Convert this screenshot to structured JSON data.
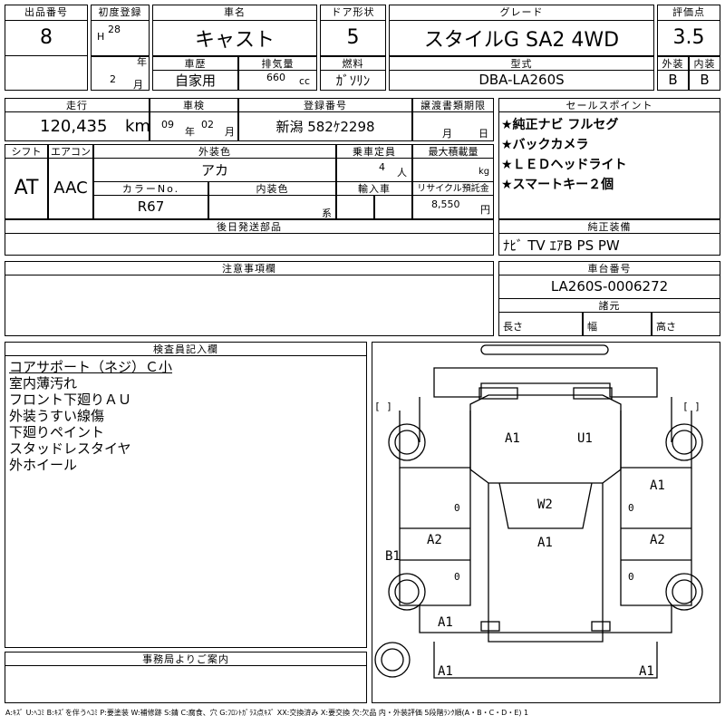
{
  "header": {
    "lot_label": "出品番号",
    "lot_value": "8",
    "first_reg_label": "初度登録",
    "era": "H",
    "year": "28",
    "year_unit": "年",
    "month": "2",
    "month_unit": "月",
    "car_name_label": "車名",
    "car_name": "キャスト",
    "door_label": "ドア形状",
    "door_value": "5",
    "grade_label": "グレード",
    "grade_value": "スタイルG SA2 4WD",
    "score_label": "評価点",
    "score_value": "3.5",
    "history_label": "車歴",
    "history_value": "自家用",
    "displacement_label": "排気量",
    "displacement_value": "660",
    "displacement_unit": "cc",
    "fuel_label": "燃料",
    "fuel_value": "ｶﾞｿﾘﾝ",
    "model_label": "型式",
    "model_value": "DBA-LA260S",
    "exterior_label": "外装",
    "exterior_value": "B",
    "interior_label": "内装",
    "interior_value": "B"
  },
  "row2": {
    "mileage_label": "走行",
    "mileage_value": "120,435",
    "mileage_unit": "km",
    "inspection_label": "車検",
    "inspection_year": "09",
    "inspection_year_unit": "年",
    "inspection_month": "02",
    "inspection_month_unit": "月",
    "reg_no_label": "登録番号",
    "reg_no_value": "新潟 582ｹ2298",
    "transfer_label": "譲渡書類期限",
    "transfer_month_unit": "月",
    "transfer_day_unit": "日"
  },
  "row3": {
    "shift_label": "シフト",
    "shift_value": "AT",
    "ac_label": "エアコン",
    "ac_value": "AAC",
    "color_label": "外装色",
    "color_value": "アカ",
    "capacity_label": "乗車定員",
    "capacity_value": "4",
    "capacity_unit": "人",
    "load_label": "最大積載量",
    "load_unit": "kg",
    "color_no_label": "カラーNo.",
    "color_no_value": "R67",
    "int_color_label": "内装色",
    "int_color_unit": "系",
    "import_label": "輸入車",
    "recycle_label": "リサイクル預託金",
    "recycle_value": "8,550",
    "recycle_unit": "円"
  },
  "sales": {
    "label": "セールスポイント",
    "items": [
      "★純正ナビ フルセグ",
      "★バックカメラ",
      "★ＬＥＤヘッドライト",
      "★スマートキー２個"
    ]
  },
  "later_parts_label": "後日発送部品",
  "equipment": {
    "label": "純正装備",
    "value": "ﾅﾋﾞ TV ｴｱB PS PW"
  },
  "notes_label": "注意事項欄",
  "chassis": {
    "label": "車台番号",
    "value": "LA260S-0006272"
  },
  "dimensions": {
    "label": "諸元",
    "length_label": "長さ",
    "width_label": "幅",
    "height_label": "高さ"
  },
  "inspector": {
    "label": "検査員記入欄",
    "lines": [
      "コアサポート（ネジ）Ｃ小",
      "室内薄汚れ",
      "フロント下廻りＡＵ",
      "外装うすい線傷",
      "下廻りペイント",
      "スタッドレスタイヤ",
      "外ホイール"
    ]
  },
  "office_label": "事務局よりご案内",
  "damage_marks": {
    "front_left": "A1",
    "front_right": "U1",
    "center": "W2",
    "center_lower": "A1",
    "left_mid": "A2",
    "right_mid": "A2",
    "right_upper": "A1",
    "left_b1": "B1",
    "rear_left": "A1",
    "bottom_left": "A1",
    "bottom_right": "A1",
    "zero_left": "0",
    "zero_right": "0",
    "zero_left2": "0",
    "zero_right2": "0",
    "bracket_left": "[   ]",
    "bracket_right": "[   ]"
  },
  "legend": "A:ｷｽﾞ U:ﾍｺﾐ B:ｷｽﾞを伴うﾍｺﾐ P:要塗装 W:補修跡 S:錆 C:腐食、穴 G:ﾌﾛﾝﾄｶﾞﾗｽ点ｷｽﾞ XX:交換済み X:要交換 欠:欠品 内・外装評価 5段階ﾗﾝｸ順(A・B・C・D・E) 1"
}
